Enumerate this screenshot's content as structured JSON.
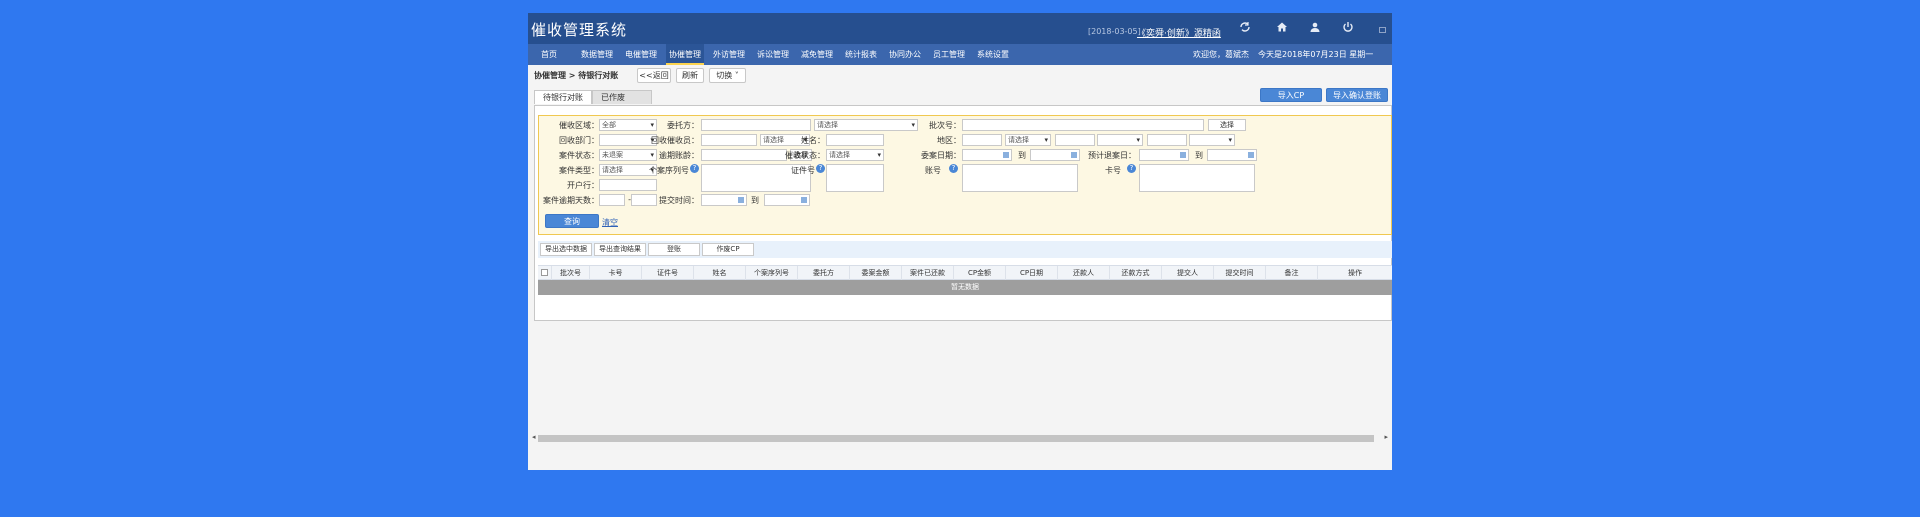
{
  "header": {
    "title": "催收管理系统",
    "date": "[2018-03-05]",
    "link": "《奕舜·创新》源精函",
    "icons": [
      "refresh-icon",
      "home-icon",
      "user-icon",
      "power-icon",
      "window-icon"
    ]
  },
  "menu": {
    "items": [
      "首页",
      "数据管理",
      "电催管理",
      "协催管理",
      "外访管理",
      "诉讼管理",
      "减免管理",
      "统计报表",
      "协同办公",
      "员工管理",
      "系统设置"
    ],
    "active_index": 3,
    "welcome": "欢迎您，葛斌杰",
    "today": "今天是2018年07月23日 星期一"
  },
  "crumb": {
    "text": "协催管理 > 待银行对账",
    "back": "<<返回",
    "refresh": "刷新",
    "switch": "切换 ˅"
  },
  "tabs": {
    "active": "待银行对账",
    "inactive": "已作废",
    "import_cp": "导入CP",
    "import_confirm": "导入确认登账"
  },
  "filter": {
    "collect_area_label": "催收区域：",
    "collect_area_value": "全部",
    "client_label": "委托方：",
    "select_placeholder": "请选择",
    "batch_label": "批次号：",
    "choose_btn": "选择",
    "collect_dept_label": "回收部门：",
    "collector_label": "回收催收员：",
    "name_label": "姓名：",
    "region_label": "地区：",
    "case_status_label": "案件状态：",
    "case_status_value": "未退案",
    "overdue_acct_label": "逾期账龄：",
    "collect_status_label": "催收状态：",
    "entrust_date_label": "委案日期：",
    "to": "到",
    "expected_return_label": "预计退案日：",
    "case_type_label": "案件类型：",
    "case_no_label": "个案序列号",
    "id_label": "证件号",
    "account_label": "账号",
    "card_label": "卡号",
    "open_bank_label": "开户行：",
    "overdue_days_label": "案件逾期天数：",
    "dash": "-",
    "submit_time_label": "提交时间：",
    "query_btn": "查询",
    "clear_link": "清空"
  },
  "actions": {
    "export_selected": "导出选中数据",
    "export_result": "导出查询结果",
    "post": "登账",
    "void_cp": "作废CP"
  },
  "table": {
    "columns": [
      "批次号",
      "卡号",
      "证件号",
      "姓名",
      "个案序列号",
      "委托方",
      "委案金额",
      "案件已还款",
      "CP金额",
      "CP日期",
      "还款人",
      "还款方式",
      "提交人",
      "提交时间",
      "备注",
      "操作"
    ],
    "empty_text": "暂无数据"
  }
}
